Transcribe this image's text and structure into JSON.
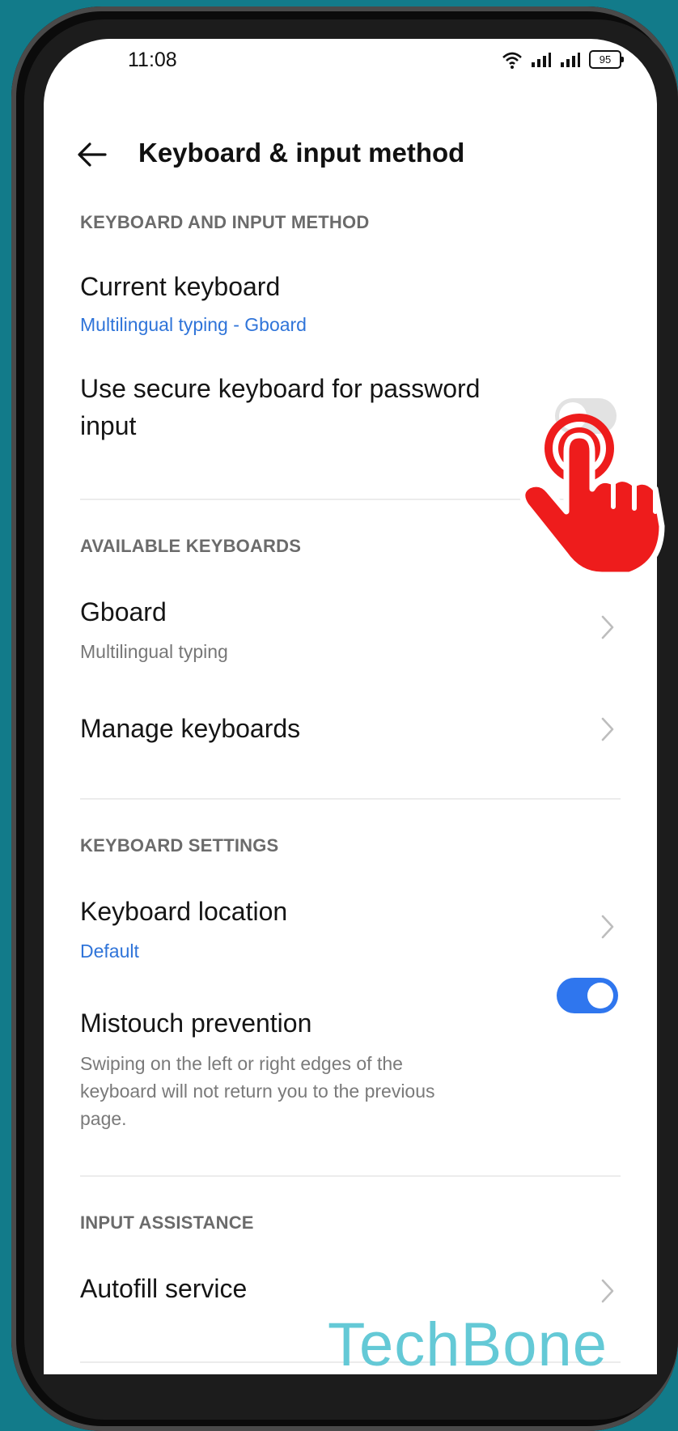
{
  "status": {
    "time": "11:08",
    "battery": "95"
  },
  "header": {
    "title": "Keyboard & input method"
  },
  "sections": {
    "kim": {
      "label": "KEYBOARD AND INPUT METHOD",
      "current_keyboard": {
        "title": "Current keyboard",
        "value": "Multilingual typing - Gboard"
      },
      "secure_keyboard": {
        "title_line1": "Use secure keyboard for password",
        "title_line2": "input",
        "enabled": false
      }
    },
    "available": {
      "label": "AVAILABLE KEYBOARDS",
      "gboard": {
        "title": "Gboard",
        "sub": "Multilingual typing"
      },
      "manage": {
        "title": "Manage keyboards"
      }
    },
    "settings": {
      "label": "KEYBOARD SETTINGS",
      "location": {
        "title": "Keyboard location",
        "value": "Default"
      },
      "mistouch": {
        "title": "Mistouch prevention",
        "desc_line1": "Swiping on the left or right edges of the",
        "desc_line2": "keyboard will not return you to the previous",
        "desc_line3": "page.",
        "enabled": true
      }
    },
    "input_assist": {
      "label": "INPUT ASSISTANCE",
      "autofill": {
        "title": "Autofill service"
      }
    }
  },
  "watermark": "TechBone",
  "colors": {
    "accent": "#2f76ee",
    "link": "#2f74d9",
    "background": "#127b8a",
    "pointer": "#ee1c1c"
  }
}
